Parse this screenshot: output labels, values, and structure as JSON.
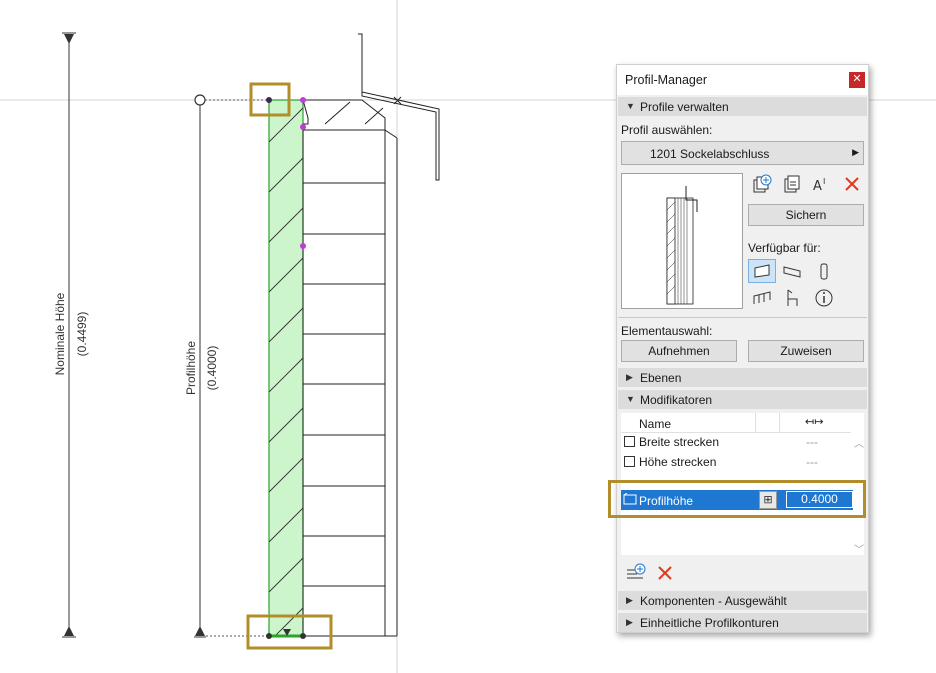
{
  "drawing": {
    "nominal_height_label": "Nominale Höhe",
    "nominal_height_value": "(0.4499)",
    "profile_height_label": "Profilhöhe",
    "profile_height_value": "(0.4000)",
    "profile_fill_color": "#ccf5cc",
    "profile_stroke_color": "#2aa52a",
    "handle_color": "#c23bd6",
    "highlight_color": "#b28e2a"
  },
  "palette": {
    "title": "Profil-Manager",
    "close_icon": "close-icon",
    "sections": {
      "profile_manage": "Profile verwalten",
      "layers": "Ebenen",
      "modifiers": "Modifikatoren",
      "components": "Komponenten - Ausgewählt",
      "uniform_contours": "Einheitliche Profilkonturen"
    },
    "select_profile_label": "Profil auswählen:",
    "selected_profile": "1201 Sockelabschluss",
    "save_button": "Sichern",
    "available_for_label": "Verfügbar für:",
    "element_selection_label": "Elementauswahl:",
    "pick_button": "Aufnehmen",
    "assign_button": "Zuweisen",
    "table": {
      "col_name": "Name",
      "rows": [
        {
          "name": "Breite strecken",
          "value": "---"
        },
        {
          "name": "Höhe strecken",
          "value": "---"
        }
      ],
      "selected_row": {
        "name": "Profilhöhe",
        "value": "0.4000"
      }
    }
  }
}
